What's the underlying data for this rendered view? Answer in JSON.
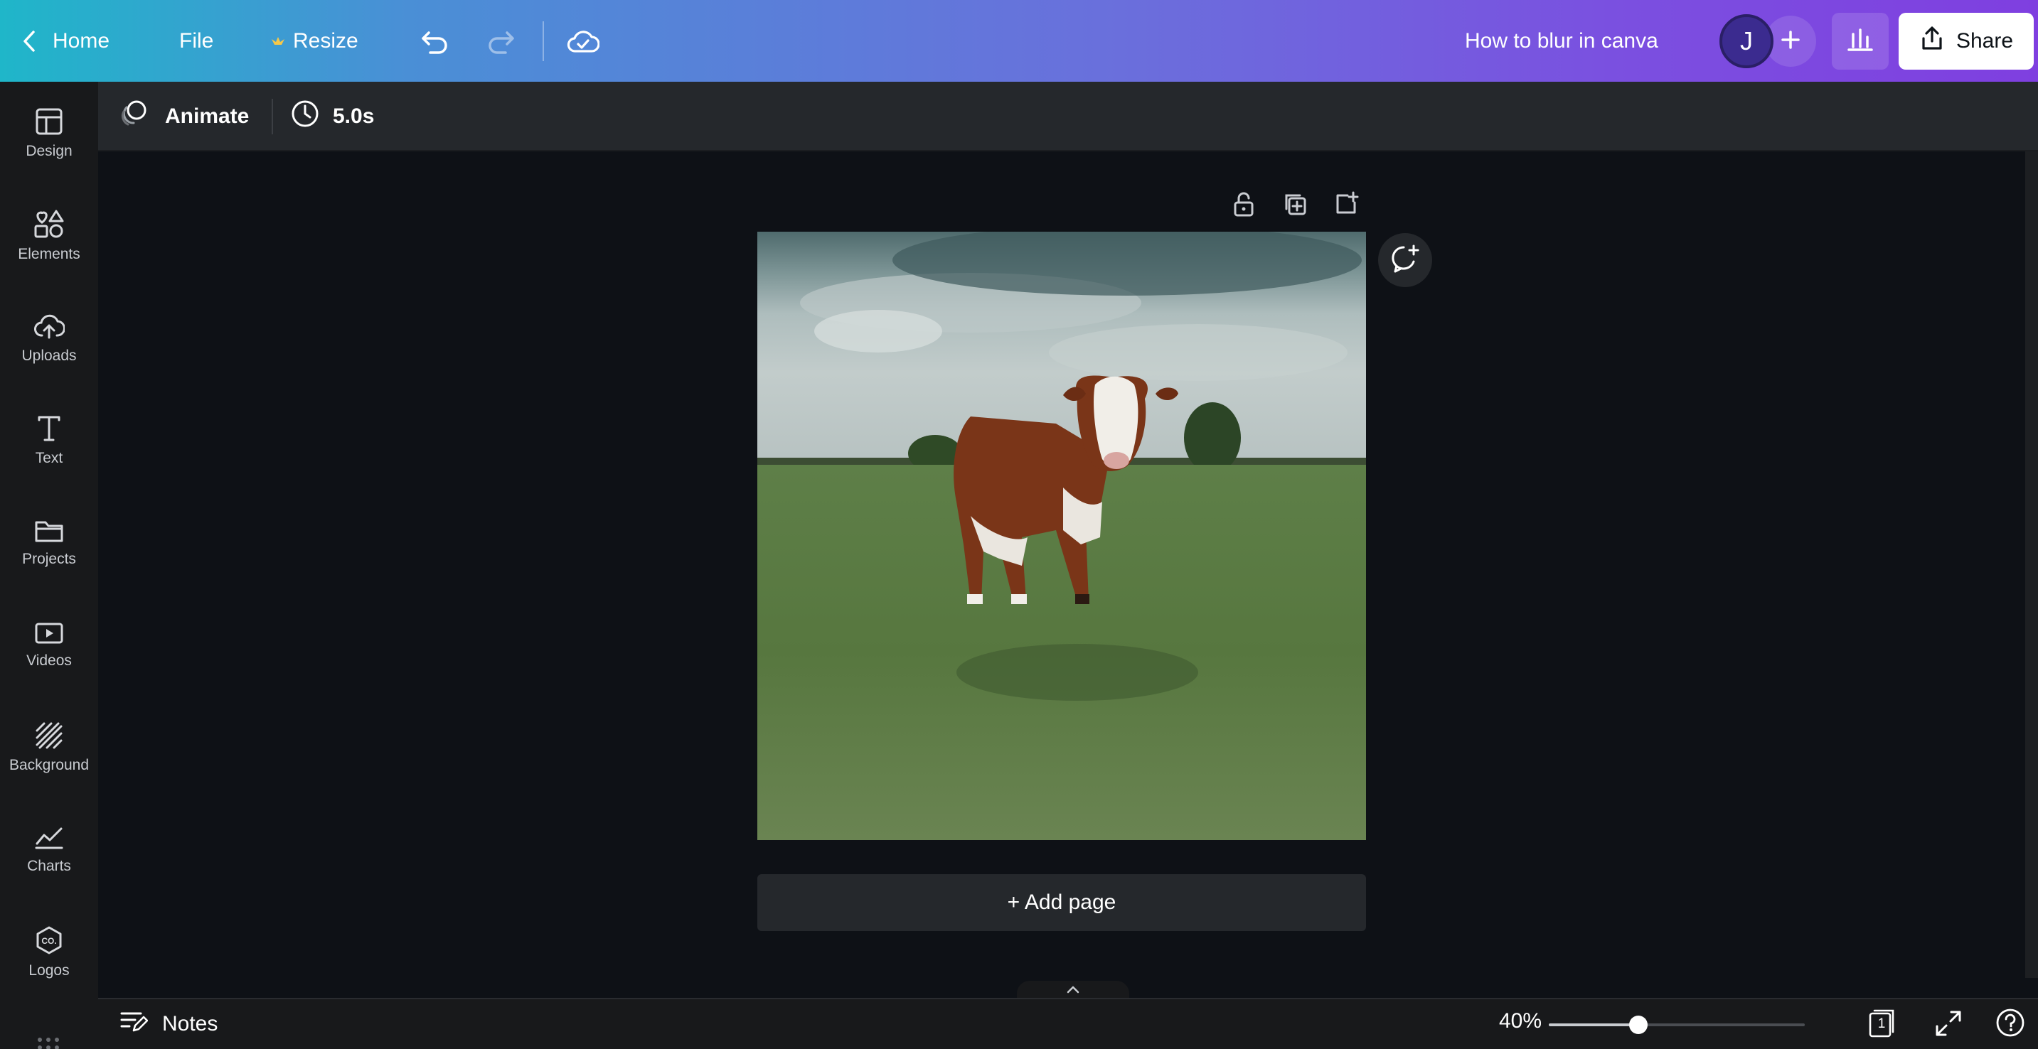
{
  "topbar": {
    "home_label": "Home",
    "file_label": "File",
    "resize_label": "Resize",
    "design_title": "How to blur in canva",
    "avatar_initial": "J",
    "share_label": "Share",
    "gradient_start": "#1fb6c9",
    "gradient_end": "#7f3fe0"
  },
  "sidebar": {
    "items": [
      {
        "label": "Design",
        "icon": "layout-icon"
      },
      {
        "label": "Elements",
        "icon": "shapes-icon"
      },
      {
        "label": "Uploads",
        "icon": "cloud-upload-icon"
      },
      {
        "label": "Text",
        "icon": "text-icon"
      },
      {
        "label": "Projects",
        "icon": "folder-icon"
      },
      {
        "label": "Videos",
        "icon": "video-icon"
      },
      {
        "label": "Background",
        "icon": "background-pattern-icon"
      },
      {
        "label": "Charts",
        "icon": "line-chart-icon"
      },
      {
        "label": "Logos",
        "icon": "logo-badge-icon"
      }
    ]
  },
  "toolbar": {
    "animate_label": "Animate",
    "duration_label": "5.0s"
  },
  "canvas": {
    "add_page_label": "+ Add page",
    "image_subject": "calf-in-field-photo"
  },
  "bottombar": {
    "notes_label": "Notes",
    "zoom_label": "40%",
    "zoom_fraction": 0.35,
    "page_count": "1"
  }
}
